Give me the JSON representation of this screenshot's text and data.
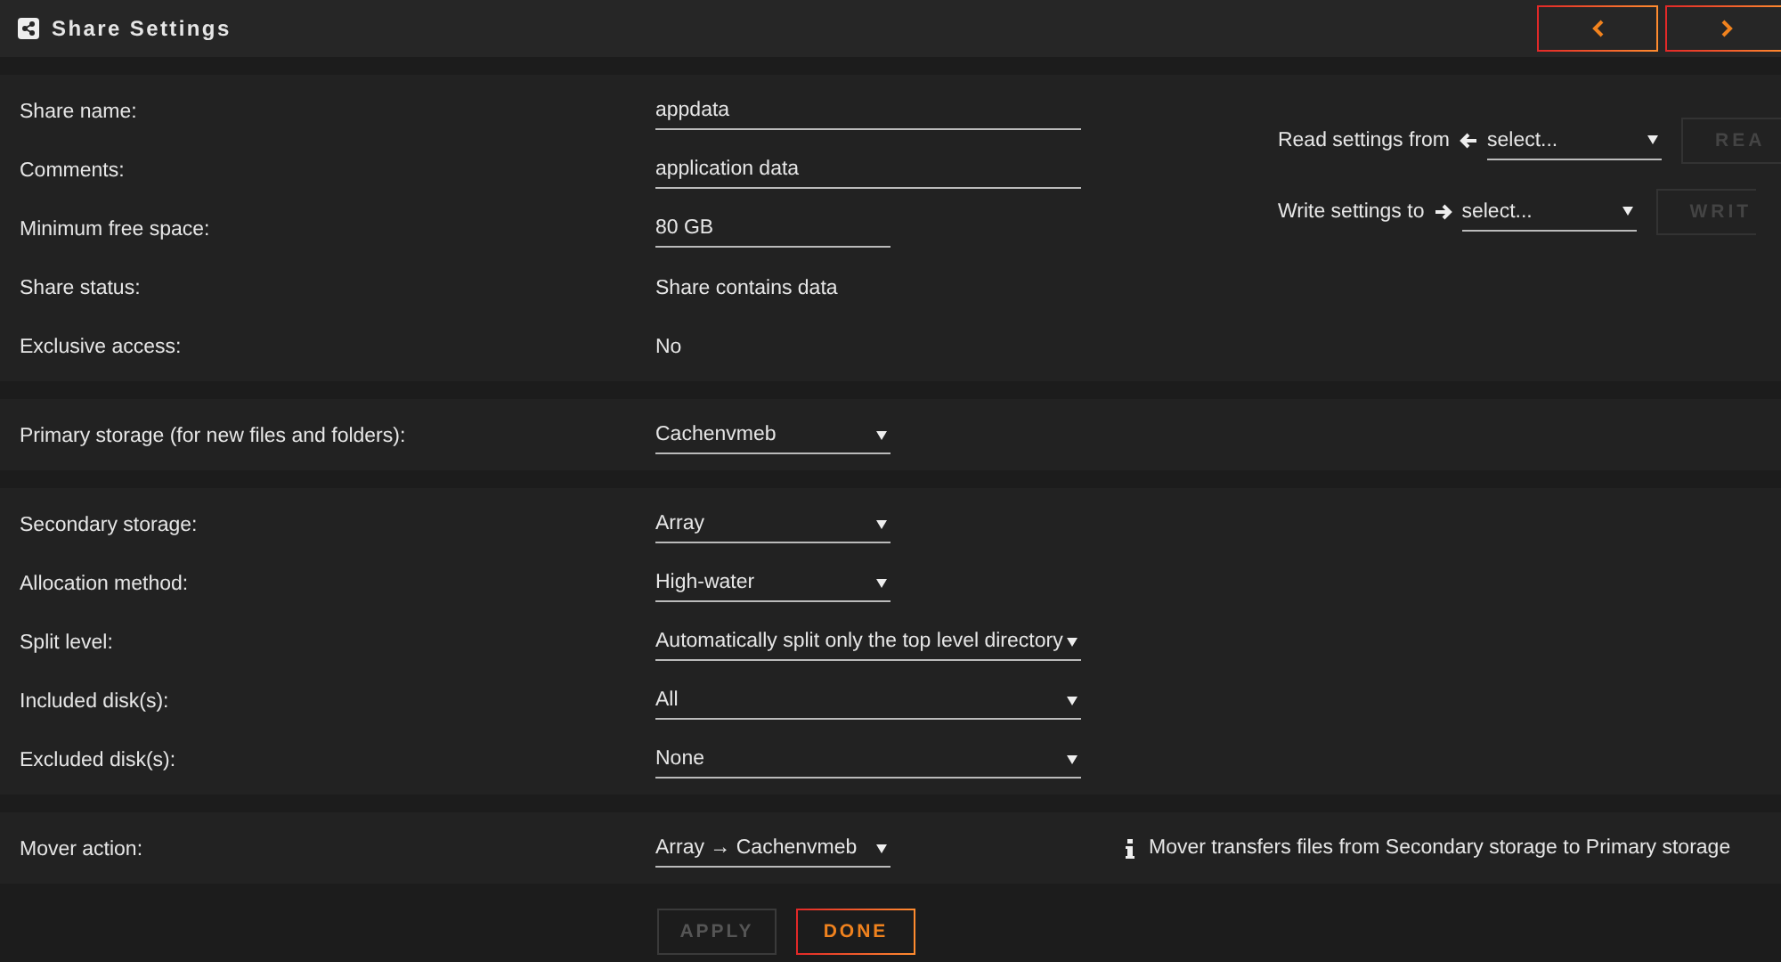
{
  "window": {
    "title": "Share Settings"
  },
  "nav_buttons": [
    {
      "kind": "prev",
      "disabled": false
    },
    {
      "kind": "next",
      "disabled": false
    }
  ],
  "sections": [
    {
      "rows": [
        {
          "label": "Share name:",
          "kind": "input",
          "value": "appdata"
        },
        {
          "label": "Comments:",
          "kind": "input",
          "value": "application data"
        },
        {
          "label": "Minimum free space:",
          "kind": "input-short",
          "value": "80 GB"
        },
        {
          "label": "Share status:",
          "kind": "text",
          "value": "Share contains data"
        },
        {
          "label": "Exclusive access:",
          "kind": "text",
          "value": "No"
        }
      ],
      "side": [
        {
          "label": "Read settings from",
          "kind": "left",
          "value": "select...",
          "button": "REA",
          "disabled": true
        },
        {
          "label": "Write settings to",
          "kind": "right",
          "value": "select...",
          "button": "WRIT",
          "disabled": true
        }
      ]
    },
    {
      "rows": [
        {
          "label": "Primary storage (for new files and folders):",
          "kind": "select",
          "value": "Cachenvmeb"
        }
      ]
    },
    {
      "rows": [
        {
          "label": "Secondary storage:",
          "kind": "select",
          "value": "Array"
        },
        {
          "label": "Allocation method:",
          "kind": "select",
          "value": "High-water"
        },
        {
          "label": "Split level:",
          "kind": "select-wide",
          "value": "Automatically split only the top level directory"
        },
        {
          "label": "Included disk(s):",
          "kind": "select-wide",
          "value": "All"
        },
        {
          "label": "Excluded disk(s):",
          "kind": "select-wide",
          "value": "None"
        }
      ]
    },
    {
      "rows": [
        {
          "label": "Mover action:",
          "kind": "select",
          "value": "Array → Cachenvmeb"
        }
      ],
      "info": "Mover transfers files from Secondary storage to Primary storage"
    }
  ],
  "buttons": [
    {
      "label": "APPLY",
      "disabled": true
    },
    {
      "label": "DONE",
      "disabled": false
    }
  ]
}
